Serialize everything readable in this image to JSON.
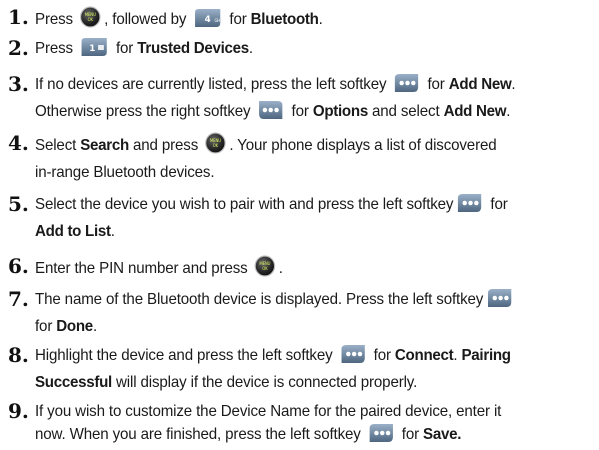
{
  "steps": [
    {
      "num": "1.",
      "lines": [
        {
          "t1": "Press ",
          "i1": "menu-ok-button-icon",
          "t2": ", followed by ",
          "i2": "key-4-icon",
          "t3": " for ",
          "b1": "Bluetooth",
          "t4": "."
        }
      ]
    },
    {
      "num": "2.",
      "lines": [
        {
          "t1": "Press ",
          "i1": "key-1-icon",
          "t2": " for ",
          "b1": "Trusted Devices",
          "t3": "."
        }
      ]
    },
    {
      "num": "3.",
      "lines": [
        {
          "t1": "If no devices are currently listed, press the left softkey ",
          "i1": "left-softkey-icon",
          "t2": " for ",
          "b1": "Add New",
          "t3": "."
        },
        {
          "t1": "Otherwise press the right softkey ",
          "i1": "right-softkey-icon",
          "t2": " for ",
          "b1": "Options",
          "t3": " and select ",
          "b2": "Add New",
          "t4": "."
        }
      ]
    },
    {
      "num": "4.",
      "lines": [
        {
          "t1": "Select ",
          "b1": "Search",
          "t2": " and press ",
          "i1": "menu-ok-button-icon",
          "t3": ". Your phone displays a list of discovered"
        },
        {
          "t1": "in-range Bluetooth devices."
        }
      ]
    },
    {
      "num": "5.",
      "lines": [
        {
          "t1": "Select the device you wish to pair with and press the left softkey",
          "i1": "left-softkey-icon",
          "t2": " for"
        },
        {
          "b1": "Add to List",
          "t1": "."
        }
      ]
    },
    {
      "num": "6.",
      "lines": [
        {
          "t1": "Enter the PIN number and press ",
          "i1": "menu-ok-button-icon",
          "t2": "."
        }
      ]
    },
    {
      "num": "7.",
      "lines": [
        {
          "t1": "The name of the Bluetooth device is displayed. Press the left softkey",
          "i1": "left-softkey-icon"
        },
        {
          "t1": "for ",
          "b1": "Done",
          "t2": "."
        }
      ]
    },
    {
      "num": "8.",
      "lines": [
        {
          "t1": "Highlight the device and press the left softkey ",
          "i1": "left-softkey-icon",
          "t2": " for ",
          "b1": "Connect",
          "t3": ". ",
          "b2": "Pairing"
        },
        {
          "b1": "Successful",
          "t1": " will display if the device is connected properly."
        }
      ]
    },
    {
      "num": "9.",
      "lines": [
        {
          "t1": "If you wish to customize the Device Name for the paired device, enter it"
        },
        {
          "t1": "now. When you are finished, press the left softkey ",
          "i1": "left-softkey-icon",
          "t2": " for ",
          "b1": "Save."
        }
      ]
    }
  ]
}
